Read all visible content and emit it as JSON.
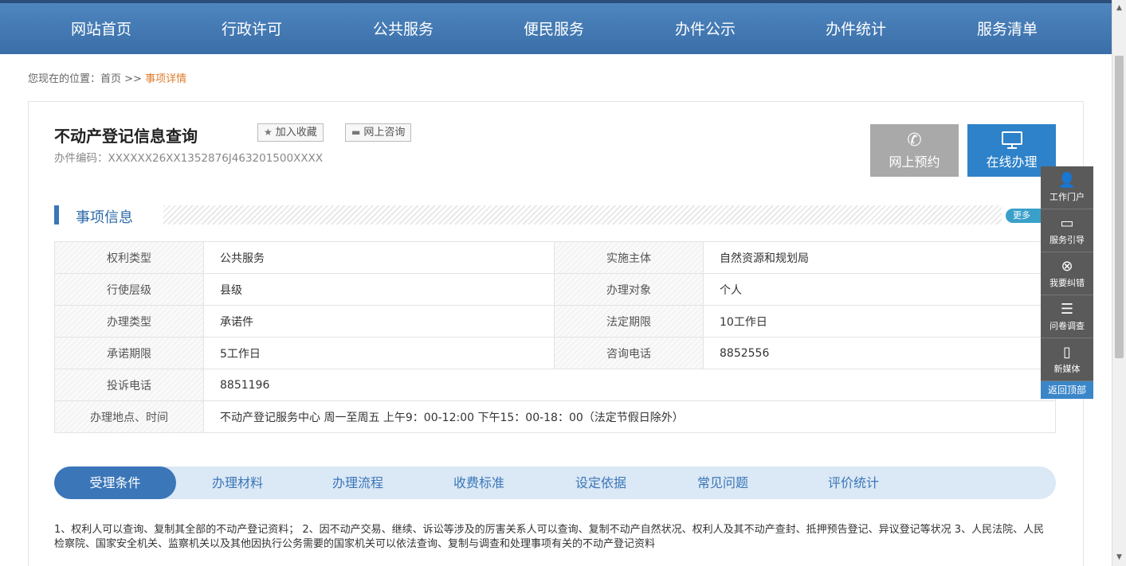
{
  "nav": [
    "网站首页",
    "行政许可",
    "公共服务",
    "便民服务",
    "办件公示",
    "办件统计",
    "服务清单"
  ],
  "breadcrumb": {
    "prefix": "您现在的位置：首页 >> ",
    "current": "事项详情"
  },
  "item": {
    "title": "不动产登记信息查询",
    "favorite_label": "加入收藏",
    "consult_label": "网上咨询",
    "code": "办件编码：XXXXXX26XX1352876J463201500XXXX"
  },
  "actions": {
    "reserve": "网上预约",
    "online": "在线办理"
  },
  "section": {
    "title": "事项信息",
    "more": "更多"
  },
  "info": [
    [
      "权利类型",
      "公共服务",
      "实施主体",
      "自然资源和规划局"
    ],
    [
      "行使层级",
      "县级",
      "办理对象",
      "个人"
    ],
    [
      "办理类型",
      "承诺件",
      "法定期限",
      "10工作日"
    ],
    [
      "承诺期限",
      "5工作日",
      "咨询电话",
      "8852556"
    ],
    [
      "投诉电话",
      "8851196"
    ],
    [
      "办理地点、时间",
      "不动产登记服务中心 周一至周五 上午9：00-12:00 下午15：00-18：00（法定节假日除外）"
    ]
  ],
  "tabs": [
    "受理条件",
    "办理材料",
    "办理流程",
    "收费标准",
    "设定依据",
    "常见问题",
    "评价统计"
  ],
  "description": "1、权利人可以查询、复制其全部的不动产登记资料； 2、因不动产交易、继续、诉讼等涉及的厉害关系人可以查询、复制不动产自然状况、权利人及其不动产查封、抵押预告登记、异议登记等状况 3、人民法院、人民检察院、国家安全机关、监察机关以及其他因执行公务需要的国家机关可以依法查询、复制与调查和处理事项有关的不动产登记资料",
  "sidebar": [
    "工作门户",
    "服务引导",
    "我要纠错",
    "问卷调查",
    "新媒体"
  ],
  "back_top": "返回顶部",
  "colors": {
    "nav": "#3a6ea8",
    "accent": "#3a76b8",
    "breadcrumb_current": "#e07b2a",
    "reserve_btn": "#a9a9a9",
    "online_btn": "#2e82c9"
  }
}
